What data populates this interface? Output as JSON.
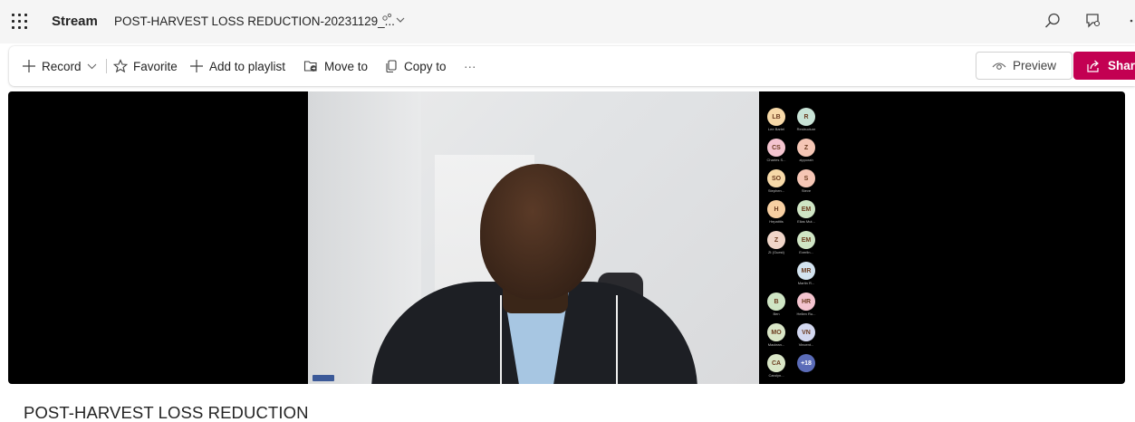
{
  "app": {
    "name": "Stream"
  },
  "document": {
    "title": "POST-HARVEST LOSS REDUCTION-20231129_..."
  },
  "commands": {
    "record": "Record",
    "favorite": "Favorite",
    "add_to_playlist": "Add to playlist",
    "move_to": "Move to",
    "copy_to": "Copy to",
    "more": "···",
    "preview": "Preview",
    "share": "Share"
  },
  "video": {
    "title": "POST-HARVEST LOSS REDUCTION",
    "participants": [
      {
        "initials": "LB",
        "name": "Lee Bartel",
        "color": "#f7d9a8"
      },
      {
        "initials": "R",
        "name": "Restructure",
        "color": "#c8e3d6"
      },
      {
        "initials": "CS",
        "name": "Charles S...",
        "color": "#f4c4cf"
      },
      {
        "initials": "Z",
        "name": "zipporah",
        "color": "#f5c6b5"
      },
      {
        "initials": "SO",
        "name": "Stephen...",
        "color": "#f7d9a8"
      },
      {
        "initials": "S",
        "name": "Steve",
        "color": "#f5c6b5"
      },
      {
        "initials": "H",
        "name": "Hepatitis",
        "color": "#f7cfa2"
      },
      {
        "initials": "EM",
        "name": "Elias Mut...",
        "color": "#cfe5c4"
      },
      {
        "initials": "Z",
        "name": "Zt (Guest)",
        "color": "#f0d5c8"
      },
      {
        "initials": "EM",
        "name": "Everlin...",
        "color": "#cfe5c4"
      },
      {
        "initials": "MR",
        "name": "Martin R...",
        "color": "#d3e3ef"
      },
      {
        "initials": "B",
        "name": "Ben",
        "color": "#cfe5c4"
      },
      {
        "initials": "HR",
        "name": "Hellen Ru...",
        "color": "#f4c4cf"
      },
      {
        "initials": "MO",
        "name": "Maclean...",
        "color": "#d9e6c7"
      },
      {
        "initials": "VN",
        "name": "Vincent...",
        "color": "#d3d8f0"
      },
      {
        "initials": "CA",
        "name": "Carolyn...",
        "color": "#d9e6c7"
      },
      {
        "initials": "+18",
        "name": "",
        "color": "#5b6cb8"
      }
    ]
  },
  "colors": {
    "accent": "#c30052",
    "topbar": "#f5f5f5"
  }
}
